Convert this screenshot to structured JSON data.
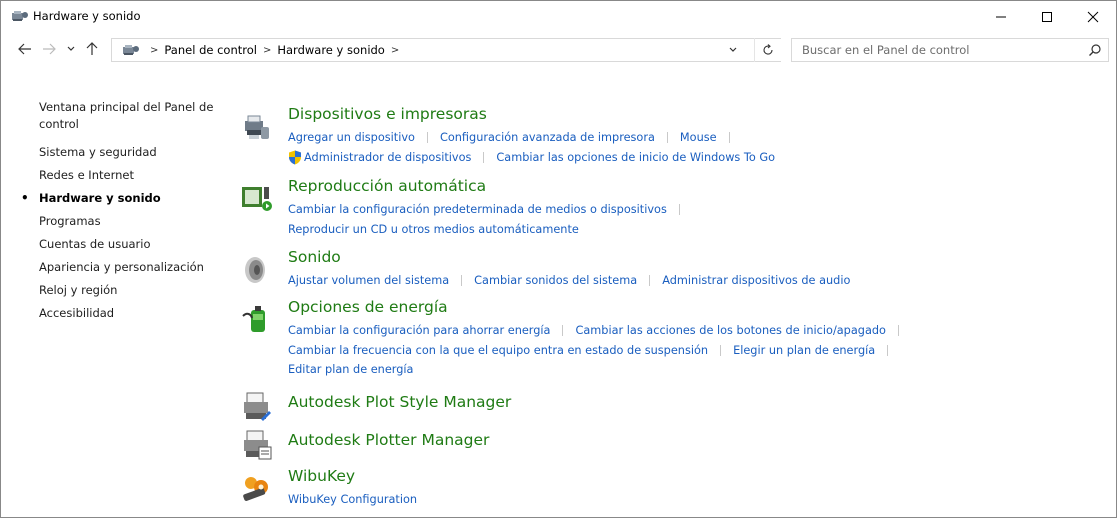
{
  "window": {
    "title": "Hardware y sonido",
    "controls": {
      "minimize": "—",
      "maximize": "☐",
      "close": "✕"
    }
  },
  "address": {
    "crumbs": [
      "Panel de control",
      "Hardware y sonido"
    ],
    "search_placeholder": "Buscar en el Panel de control"
  },
  "sidebar": {
    "items": [
      {
        "label": "Ventana principal del Panel de control",
        "current": false
      },
      {
        "label": "Sistema y seguridad",
        "current": false
      },
      {
        "label": "Redes e Internet",
        "current": false
      },
      {
        "label": "Hardware y sonido",
        "current": true
      },
      {
        "label": "Programas",
        "current": false
      },
      {
        "label": "Cuentas de usuario",
        "current": false
      },
      {
        "label": "Apariencia y personalización",
        "current": false
      },
      {
        "label": "Reloj y región",
        "current": false
      },
      {
        "label": "Accesibilidad",
        "current": false
      }
    ]
  },
  "categories": [
    {
      "title": "Dispositivos e impresoras",
      "icon": "printer-devices-icon",
      "rows": [
        [
          "Agregar un dispositivo",
          "Configuración avanzada de impresora",
          "Mouse"
        ],
        [
          "Administrador de dispositivos",
          "Cambiar las opciones de inicio de Windows To Go"
        ]
      ]
    },
    {
      "title": "Reproducción automática",
      "icon": "autoplay-icon",
      "rows": [
        [
          "Cambiar la configuración predeterminada de medios o dispositivos"
        ],
        [
          "Reproducir un CD u otros medios automáticamente"
        ]
      ]
    },
    {
      "title": "Sonido",
      "icon": "speaker-icon",
      "rows": [
        [
          "Ajustar volumen del sistema",
          "Cambiar sonidos del sistema",
          "Administrar dispositivos de audio"
        ]
      ]
    },
    {
      "title": "Opciones de energía",
      "icon": "power-options-icon",
      "rows": [
        [
          "Cambiar la configuración para ahorrar energía",
          "Cambiar las acciones de los botones de inicio/apagado"
        ],
        [
          "Cambiar la frecuencia con la que el equipo entra en estado de suspensión",
          "Elegir un plan de energía"
        ],
        [
          "Editar plan de energía"
        ]
      ]
    },
    {
      "title": "Autodesk Plot Style Manager",
      "icon": "plot-style-manager-icon",
      "rows": []
    },
    {
      "title": "Autodesk Plotter Manager",
      "icon": "plotter-manager-icon",
      "rows": []
    },
    {
      "title": "WibuKey",
      "icon": "wibukey-icon",
      "rows": [
        [
          "WibuKey Configuration"
        ]
      ]
    }
  ],
  "colors": {
    "category_title": "#1f7b14",
    "link": "#1a5ebf"
  }
}
